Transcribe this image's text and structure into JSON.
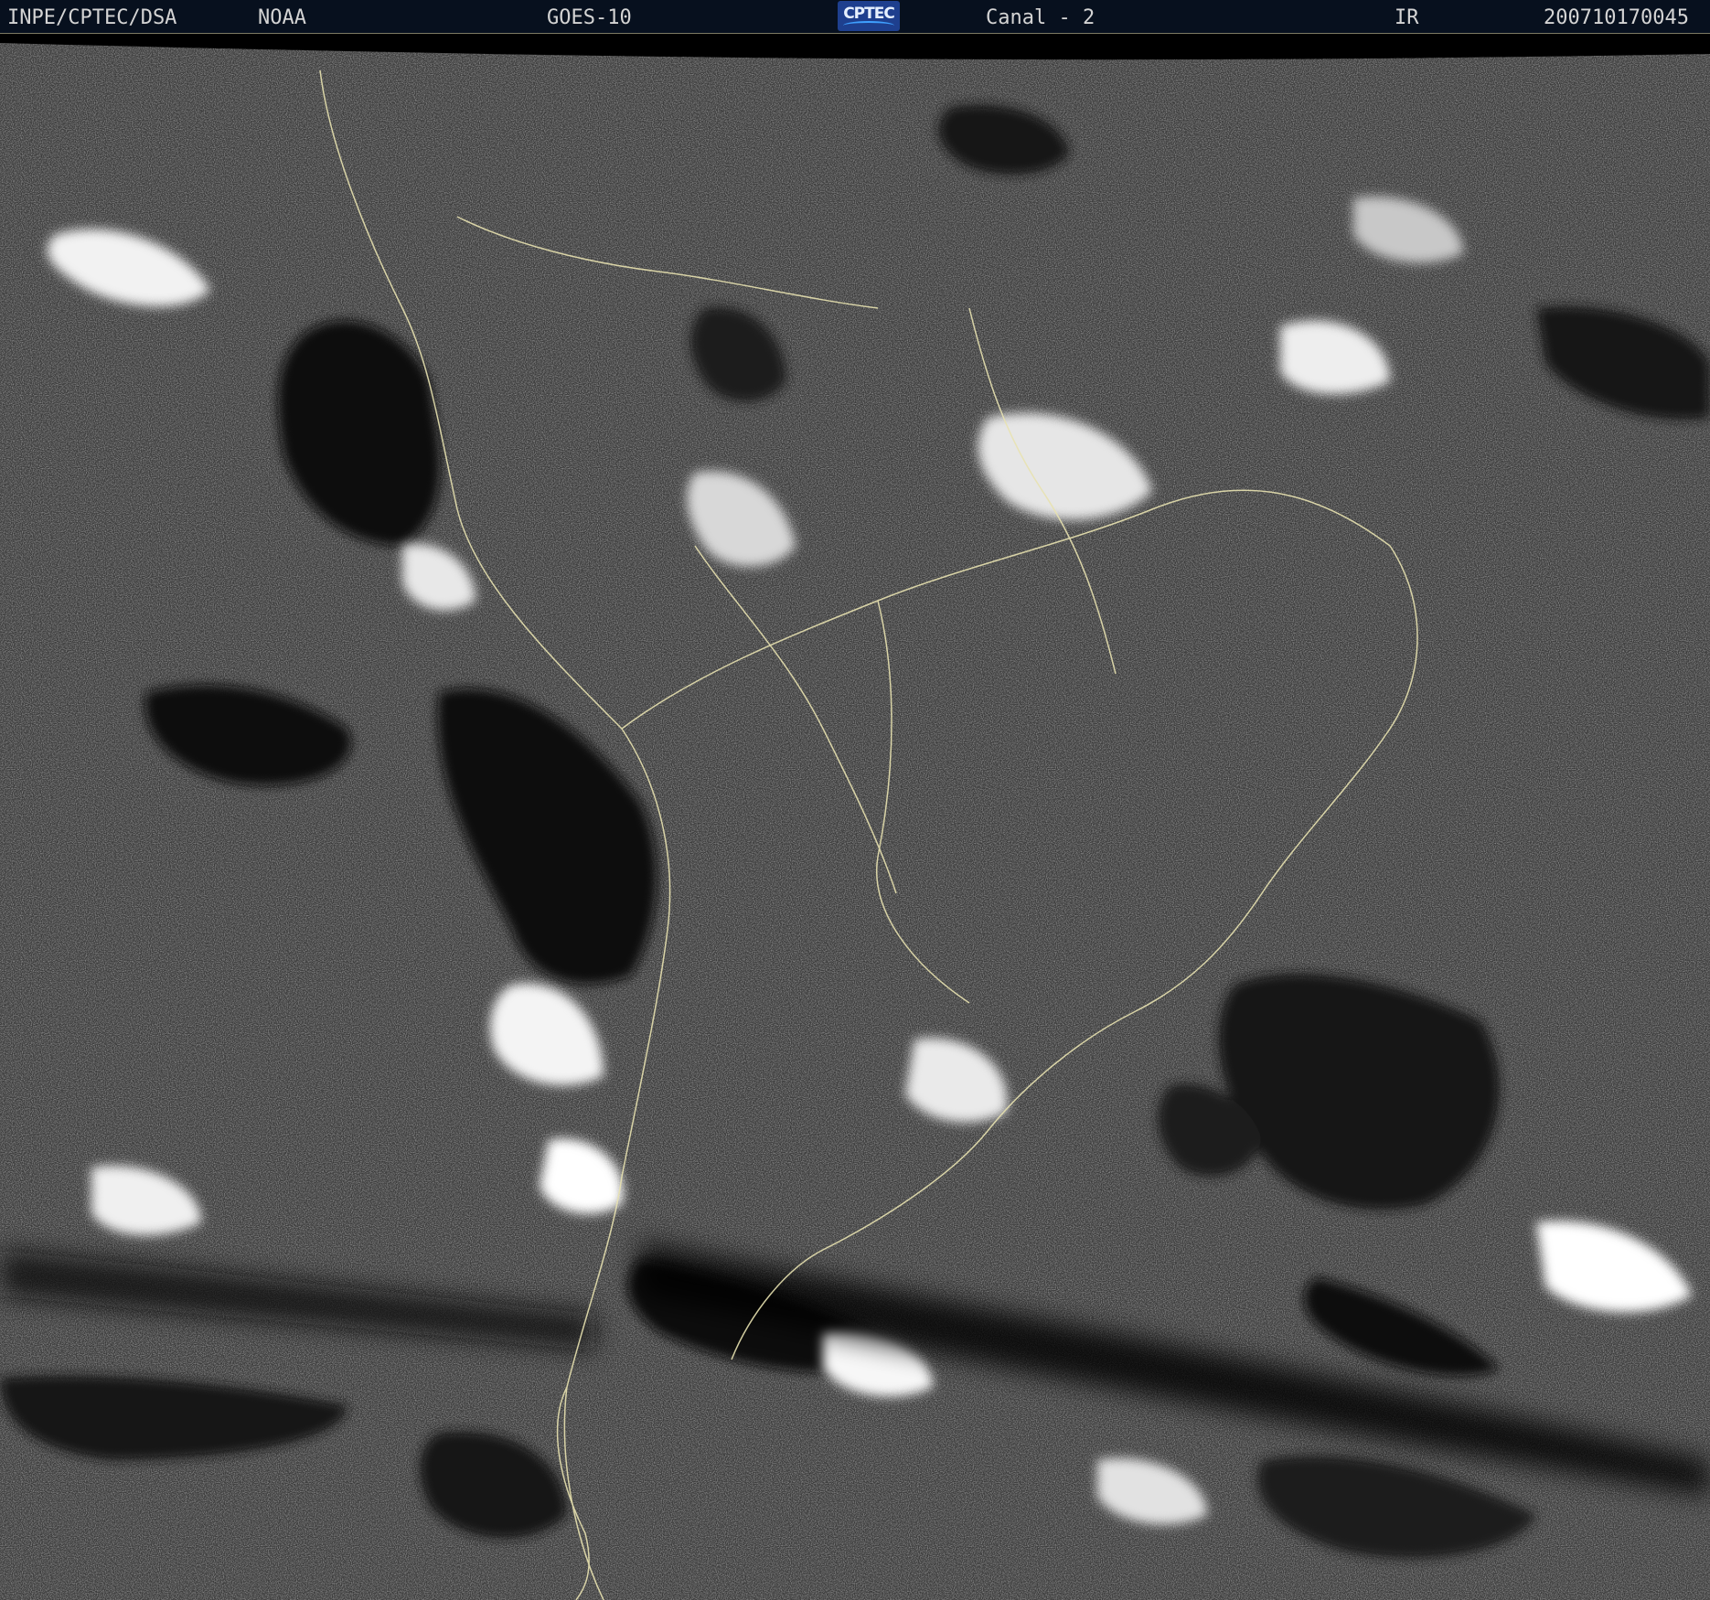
{
  "header": {
    "institution": "INPE/CPTEC/DSA",
    "agency": "NOAA",
    "satellite": "GOES-10",
    "logo_text": "CPTEC",
    "channel": "Canal - 2",
    "band": "IR",
    "timestamp": "200710170045"
  },
  "imagery": {
    "description_colors": {
      "background": "#07101e",
      "text": "#d4d4d4",
      "coastline": "#e8e2b0",
      "logo": "#1e3f8e"
    }
  }
}
